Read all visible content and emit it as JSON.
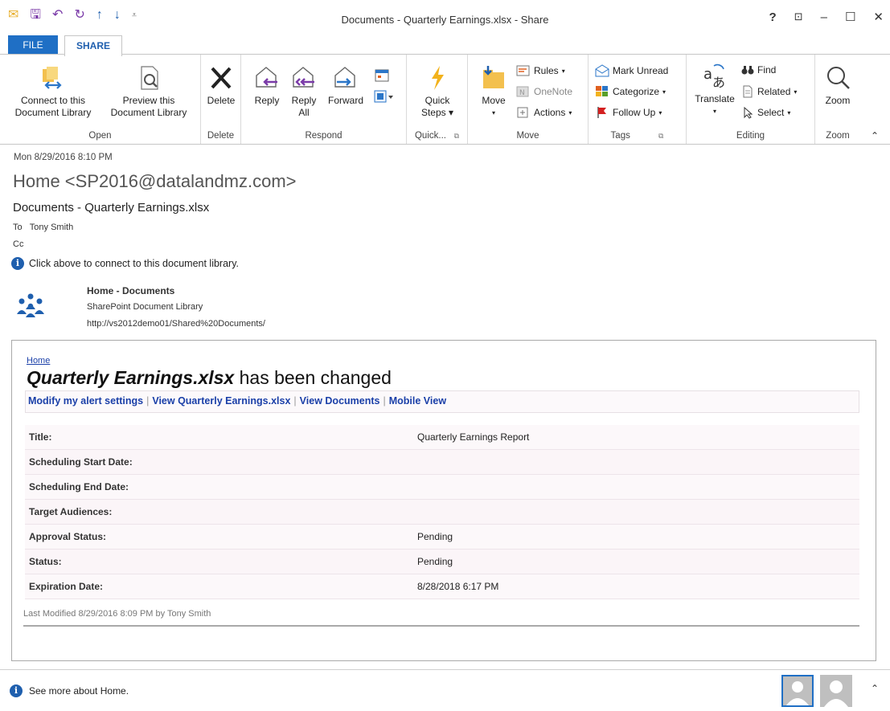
{
  "window": {
    "title": "Documents - Quarterly Earnings.xlsx - Share",
    "controls": [
      "?",
      "⊡",
      "–",
      "☐",
      "✕"
    ]
  },
  "tabs": {
    "file": "FILE",
    "share": "SHARE"
  },
  "ribbon": {
    "open": {
      "connect": "Connect to this Document Library",
      "connect_l1": "Connect to this",
      "connect_l2": "Document Library",
      "preview_l1": "Preview this",
      "preview_l2": "Document Library",
      "label": "Open"
    },
    "delete": {
      "button": "Delete",
      "label": "Delete"
    },
    "respond": {
      "reply": "Reply",
      "reply_all_l1": "Reply",
      "reply_all_l2": "All",
      "forward": "Forward",
      "label": "Respond"
    },
    "quick": {
      "l1": "Quick",
      "l2": "Steps",
      "label": "Quick..."
    },
    "move": {
      "button": "Move",
      "rules": "Rules",
      "onenote": "OneNote",
      "actions": "Actions",
      "label": "Move"
    },
    "tags": {
      "mark_unread": "Mark Unread",
      "categorize": "Categorize",
      "follow_up": "Follow Up",
      "label": "Tags"
    },
    "editing": {
      "translate": "Translate",
      "find": "Find",
      "related": "Related",
      "select": "Select",
      "label": "Editing"
    },
    "zoom": {
      "button": "Zoom",
      "label": "Zoom"
    }
  },
  "message": {
    "date": "Mon 8/29/2016 8:10 PM",
    "from": "Home <SP2016@datalandmz.com>",
    "subject": "Documents - Quarterly Earnings.xlsx",
    "to_label": "To",
    "to_value": "Tony Smith",
    "cc_label": "Cc",
    "info": "Click above to connect to this document library.",
    "library": {
      "title": "Home - Documents",
      "type": "SharePoint Document Library",
      "url": "http://vs2012demo01/Shared%20Documents/"
    }
  },
  "alert": {
    "home_link": "Home",
    "title_bold": "Quarterly Earnings.xlsx",
    "title_rest": " has been changed",
    "links": [
      "Modify my alert settings",
      "View Quarterly Earnings.xlsx",
      "View Documents",
      "Mobile View"
    ],
    "properties": [
      {
        "name": "Title:",
        "value": "Quarterly Earnings Report"
      },
      {
        "name": "Scheduling Start Date:",
        "value": ""
      },
      {
        "name": "Scheduling End Date:",
        "value": ""
      },
      {
        "name": "Target Audiences:",
        "value": ""
      },
      {
        "name": "Approval Status:",
        "value": "Pending"
      },
      {
        "name": "Status:",
        "value": "Pending"
      },
      {
        "name": "Expiration Date:",
        "value": "8/28/2018 6:17 PM"
      }
    ],
    "last_modified": "Last Modified 8/29/2016 8:09 PM by Tony Smith"
  },
  "footer": {
    "see_more": "See more about Home."
  },
  "colors": {
    "accent": "#1f6fc5",
    "link": "#1a3fa8"
  }
}
